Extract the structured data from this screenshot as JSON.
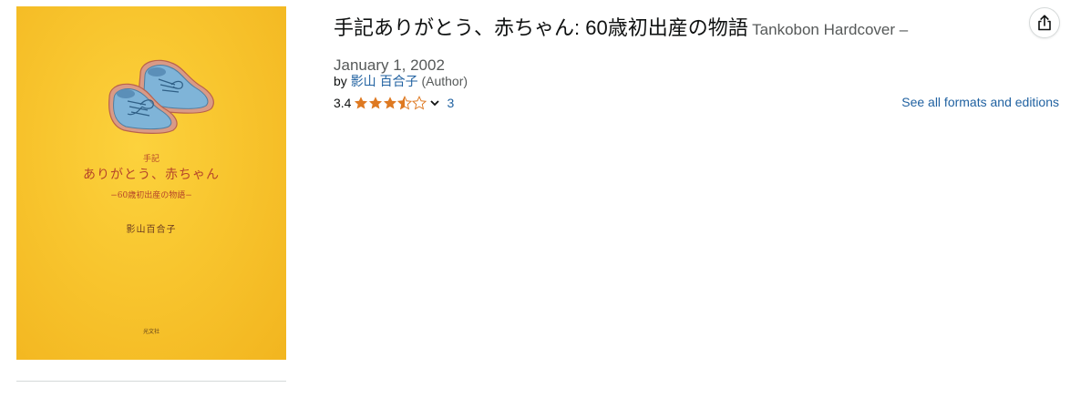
{
  "product": {
    "title": "手記ありがとう、赤ちゃん: 60歳初出産の物語",
    "binding": "Tankobon Hardcover –",
    "date": "January 1, 2002",
    "by_label": "by",
    "author": "影山 百合子",
    "author_role": "(Author)",
    "rating_value": "3.4",
    "rating_stars": 3.5,
    "rating_count": "3",
    "formats_link": "See all formats and editions"
  },
  "cover": {
    "small_label": "手記",
    "title": "ありがとう、赤ちゃん",
    "subtitle": "−60歳初出産の物語−",
    "author": "影山百合子",
    "publisher": "光文社",
    "background_color": "#f8c52e",
    "text_color": "#b5452a",
    "illustration": "baby-shoes"
  },
  "icons": {
    "share": "share-icon",
    "chevron": "chevron-down-icon",
    "star": "star-icon"
  },
  "colors": {
    "link": "#2162a1",
    "star": "#de7921",
    "text": "#0f1111",
    "muted": "#565959"
  }
}
